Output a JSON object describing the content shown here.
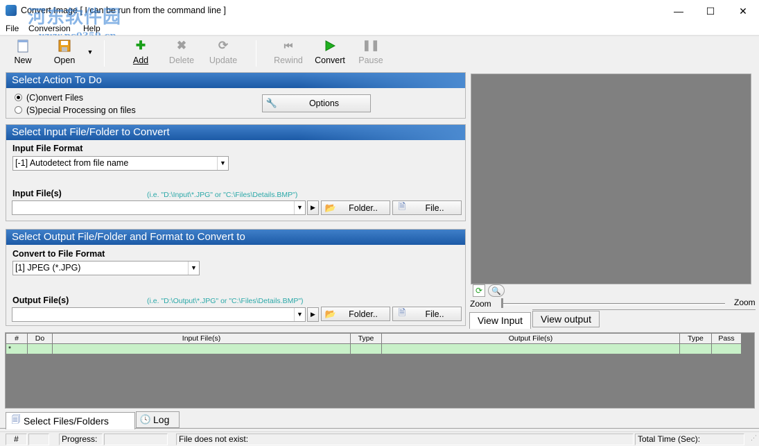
{
  "window": {
    "title": "Convert Image  [ I can be run from the command line ]",
    "minimize_glyph": "—",
    "maximize_glyph": "☐",
    "close_glyph": "✕"
  },
  "watermark": {
    "line1": "河东软件园",
    "line2": "www.pc0359.cn"
  },
  "menu": {
    "file": "File",
    "conversion": "Conversion",
    "help": "Help"
  },
  "toolbar": {
    "new": "New",
    "open": "Open",
    "add": "Add",
    "delete": "Delete",
    "update": "Update",
    "rewind": "Rewind",
    "convert": "Convert",
    "pause": "Pause"
  },
  "action": {
    "header": "Select Action To Do",
    "convert_files": "(C)onvert Files",
    "special_processing": "(S)pecial Processing on files",
    "selected": "convert_files",
    "options_button": "Options"
  },
  "input": {
    "header": "Select Input File/Folder to Convert",
    "format_label": "Input File Format",
    "format_value": "[-1] Autodetect from file name",
    "files_label": "Input File(s)",
    "hint": "(i.e. \"D:\\Input\\*.JPG\"  or \"C:\\Files\\Details.BMP\")",
    "files_value": "",
    "folder_button": "Folder..",
    "file_button": "File.."
  },
  "output": {
    "header": "Select Output File/Folder and Format to Convert to",
    "format_label": "Convert to File Format",
    "format_value": "[1] JPEG (*.JPG)",
    "files_label": "Output File(s)",
    "hint": "(i.e. \"D:\\Output\\*.JPG\"  or \"C:\\Files\\Details.BMP\")",
    "files_value": "",
    "folder_button": "Folder..",
    "file_button": "File.."
  },
  "preview": {
    "zoom_left": "Zoom",
    "zoom_right": "Zoom",
    "view_input": "View Input",
    "view_output": "View output"
  },
  "grid": {
    "columns": [
      "#",
      "Do",
      "Input File(s)",
      "Type",
      "Output File(s)",
      "Type",
      "Pass"
    ],
    "rows": [
      [
        "*",
        "",
        "",
        "",
        "",
        "",
        ""
      ]
    ]
  },
  "tabs": {
    "select_files": "Select Files/Folders",
    "log": "Log"
  },
  "status": {
    "hash": "#",
    "progress": "Progress:",
    "message": "File does not exist:",
    "total_time": "Total Time (Sec):"
  },
  "colors": {
    "header_blue": "#1c5aa6",
    "grid_row": "#c8f0c8",
    "hint_teal": "#2aa8a8"
  }
}
